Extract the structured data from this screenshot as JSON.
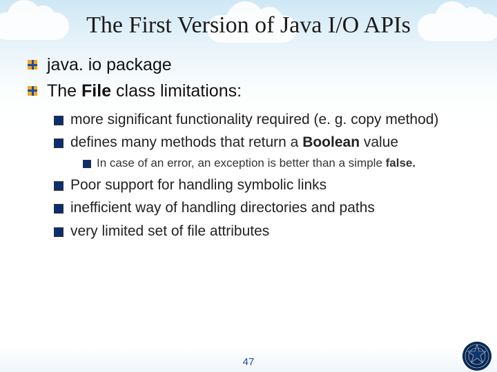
{
  "title": "The First Version of Java I/O APIs",
  "bullets": {
    "l1_0": "java. io package",
    "l1_1_pre": "The ",
    "l1_1_bold": "File",
    "l1_1_post": " class limitations:",
    "l2_0": "more significant functionality required (e. g. copy method)",
    "l2_1_pre": "defines many methods that return a ",
    "l2_1_bold": "Boolean",
    "l2_1_post": " value",
    "l3_0_pre": "In case of an error, an exception is better than a simple ",
    "l3_0_bold": "false.",
    "l2_2": "Poor support for handling symbolic links",
    "l2_3": "inefficient way of handling directories and paths",
    "l2_4": "very limited set of file attributes"
  },
  "page_number": "47"
}
